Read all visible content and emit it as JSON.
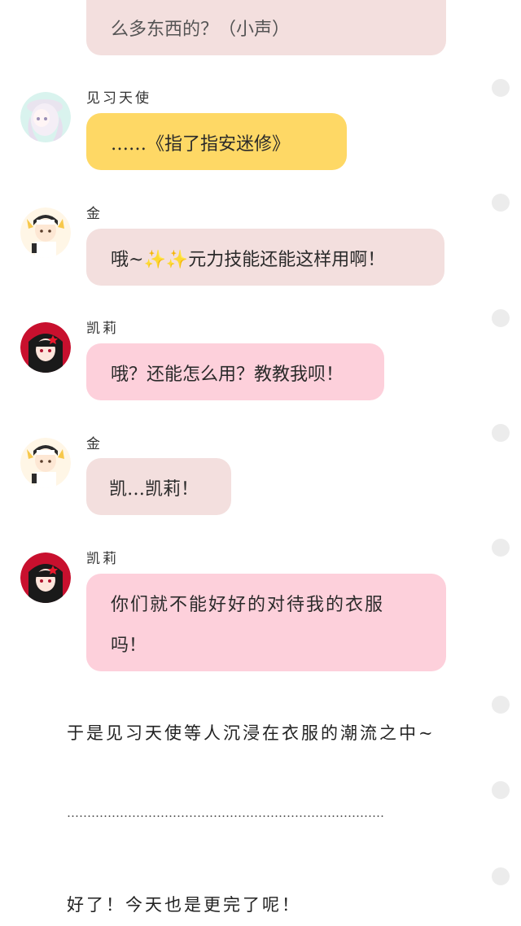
{
  "messages": [
    {
      "speaker": "",
      "text": "么多东西的？（小声）"
    },
    {
      "speaker": "见习天使",
      "text": "……《指了指安迷修》"
    },
    {
      "speaker": "金",
      "text_before": "哦~",
      "emoji": "✨✨",
      "text_after": "元力技能还能这样用啊！"
    },
    {
      "speaker": "凯莉",
      "text": "哦？还能怎么用？教教我呗！"
    },
    {
      "speaker": "金",
      "text": "凯…凯莉！"
    },
    {
      "speaker": "凯莉",
      "line1": "你们就不能好好的对待我的衣服",
      "line2": "吗！"
    }
  ],
  "narration": {
    "line1": "于是见习天使等人沉浸在衣服的潮流之中~",
    "ellipsis": "……………………………………………………………………",
    "line2": "好了！今天也是更完了呢！"
  },
  "colors": {
    "bubble_beige": "#f3dfde",
    "bubble_yellow": "#fed865",
    "bubble_pink": "#fdd0db",
    "dot": "#ececec"
  },
  "icons": {
    "avatar_angel": "angel-avatar",
    "avatar_jin": "jin-avatar",
    "avatar_kelly": "kelly-avatar",
    "sparkle": "sparkles-emoji"
  }
}
